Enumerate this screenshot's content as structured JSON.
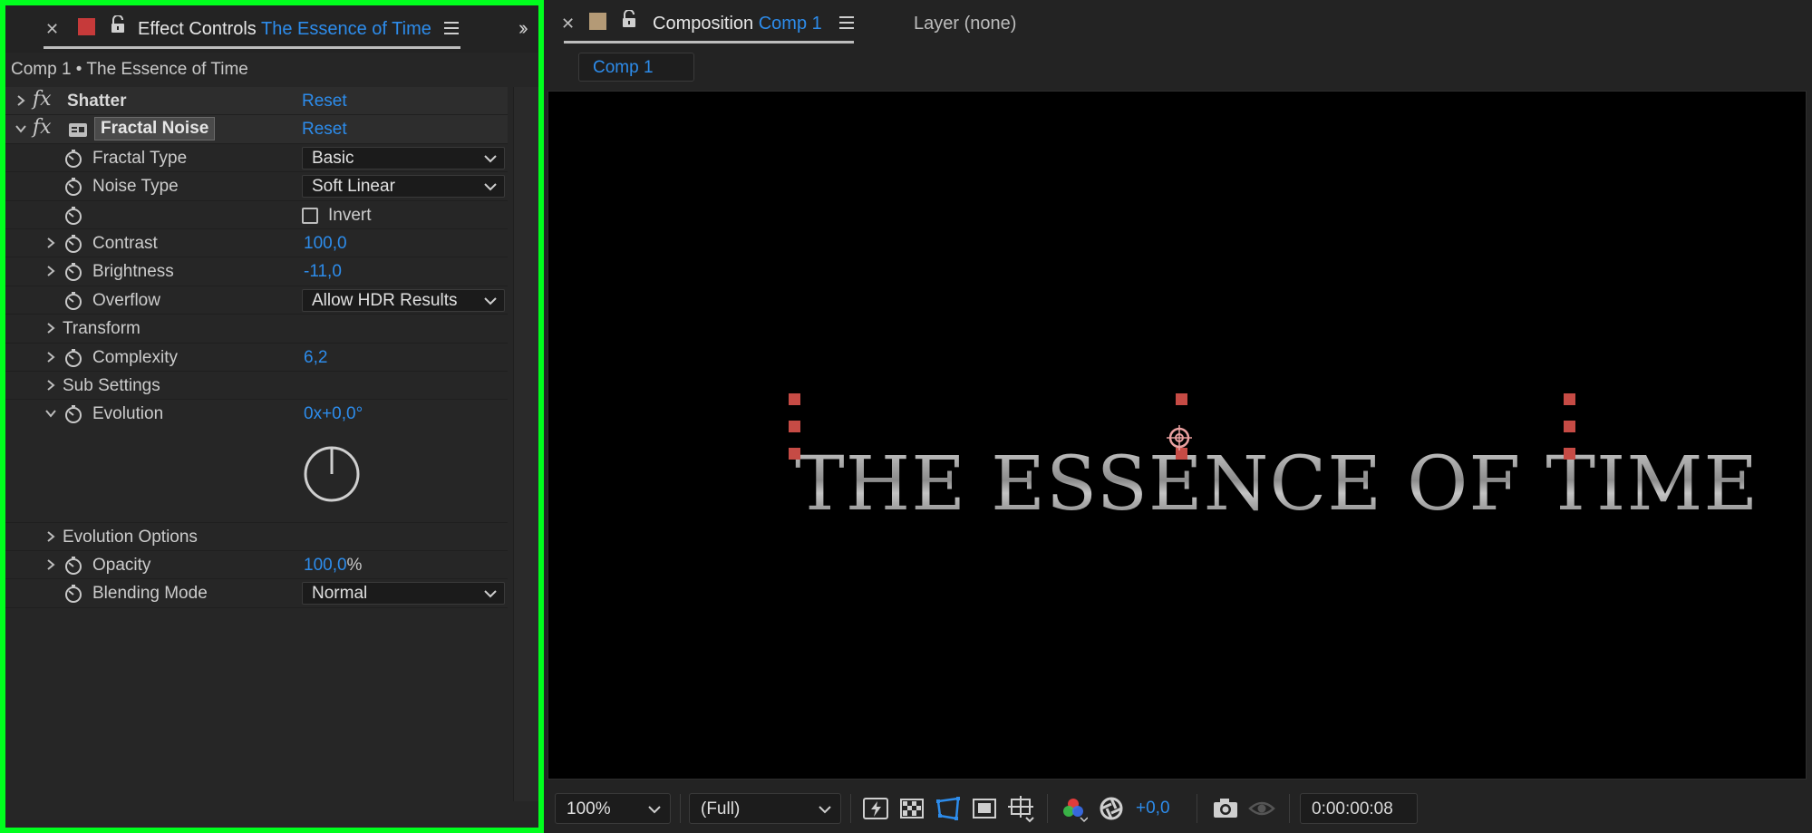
{
  "effect_controls": {
    "tab_label": "Effect Controls",
    "tab_layer": "The Essence of Time",
    "comp_path": "Comp 1 • The Essence of Time",
    "effects": [
      {
        "name": "Shatter",
        "reset": "Reset",
        "expanded": false
      },
      {
        "name": "Fractal Noise",
        "reset": "Reset",
        "expanded": true
      }
    ],
    "properties": {
      "fractal_type": {
        "label": "Fractal Type",
        "value": "Basic"
      },
      "noise_type": {
        "label": "Noise Type",
        "value": "Soft Linear"
      },
      "invert": {
        "label": "Invert",
        "checked": false
      },
      "contrast": {
        "label": "Contrast",
        "value": "100,0"
      },
      "brightness": {
        "label": "Brightness",
        "value": "-11,0"
      },
      "overflow": {
        "label": "Overflow",
        "value": "Allow HDR Results"
      },
      "transform": {
        "label": "Transform"
      },
      "complexity": {
        "label": "Complexity",
        "value": "6,2"
      },
      "sub_settings": {
        "label": "Sub Settings"
      },
      "evolution": {
        "label": "Evolution",
        "value": "0x+0,0°"
      },
      "evolution_options": {
        "label": "Evolution Options"
      },
      "opacity": {
        "label": "Opacity",
        "value": "100,0",
        "unit": "%"
      },
      "blending_mode": {
        "label": "Blending Mode",
        "value": "Normal"
      }
    }
  },
  "composition": {
    "tab_label": "Composition",
    "tab_comp": "Comp 1",
    "layer_tab": "Layer (none)",
    "breadcrumb_chip": "Comp 1",
    "viewer_text": "THE ESSENCE OF TIME"
  },
  "viewer_bar": {
    "zoom": "100%",
    "resolution": "(Full)",
    "exposure": "+0,0",
    "timecode": "0:00:00:08"
  },
  "colors": {
    "accent": "#2d8ceb",
    "highlight_border": "#00ff1e",
    "label_swatch_effect": "#c63a3a",
    "label_swatch_comp": "#b49a76",
    "handle": "#c64b45"
  }
}
